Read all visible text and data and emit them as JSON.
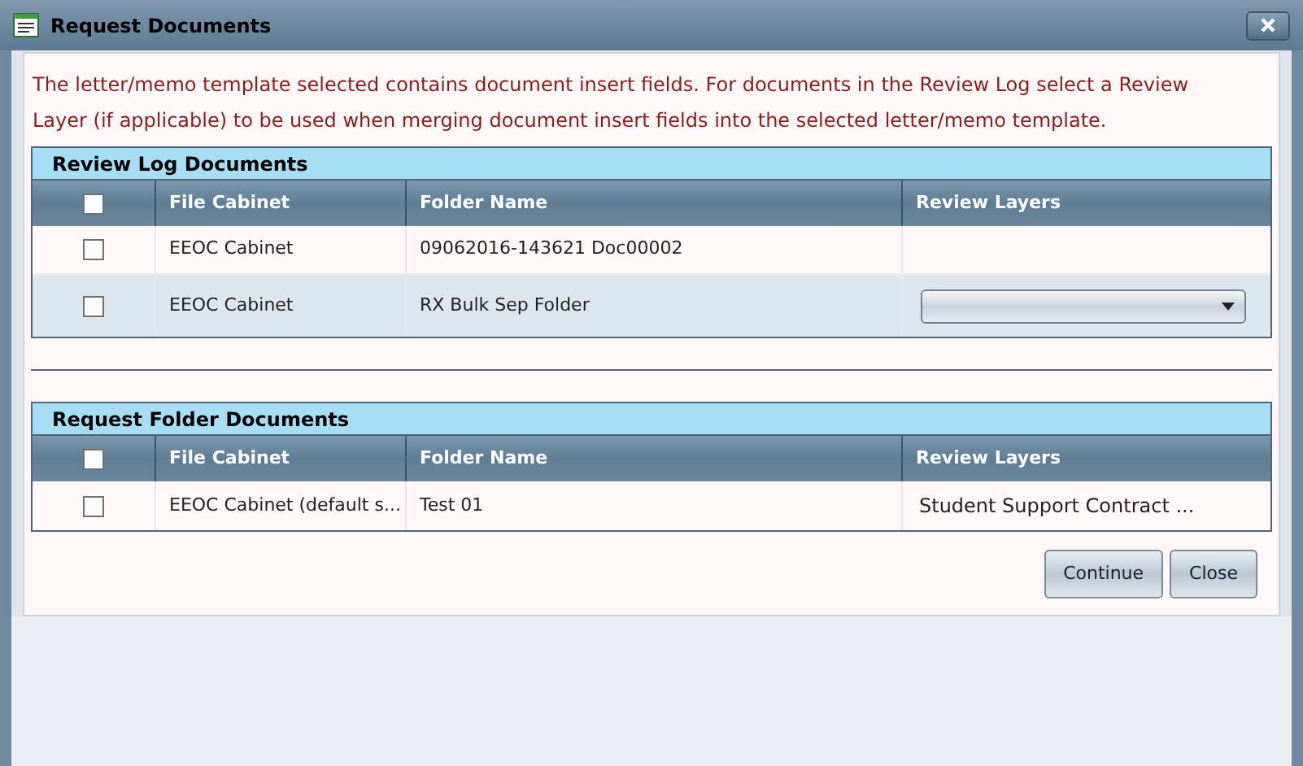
{
  "window": {
    "title": "Request Documents"
  },
  "message": "The letter/memo template selected contains document insert fields. For documents in the Review Log select a Review Layer (if applicable) to be used when merging document insert fields into the selected letter/memo template.",
  "sections": [
    {
      "title": "Review Log Documents",
      "header_checked": false,
      "columns": [
        "File Cabinet",
        "Folder Name",
        "Review Layers"
      ],
      "rows": [
        {
          "checked": false,
          "selected": false,
          "file_cabinet": "EEOC Cabinet",
          "folder_name": "09062016-143621 Doc00002",
          "review_layer": {
            "kind": "text"
          }
        },
        {
          "checked": false,
          "selected": true,
          "file_cabinet": "EEOC Cabinet",
          "folder_name": "RX Bulk Sep Folder",
          "review_layer": {
            "kind": "dropdown"
          }
        }
      ]
    },
    {
      "title": "Request Folder Documents",
      "header_checked": false,
      "columns": [
        "File Cabinet",
        "Folder Name",
        "Review Layers"
      ],
      "rows": [
        {
          "checked": false,
          "selected": false,
          "file_cabinet": "EEOC Cabinet (default s...",
          "folder_name": "Test 01",
          "review_layer": {
            "kind": "text",
            "value": "Student Support Contract ..."
          }
        }
      ]
    }
  ],
  "buttons": [
    "Continue",
    "Close"
  ]
}
